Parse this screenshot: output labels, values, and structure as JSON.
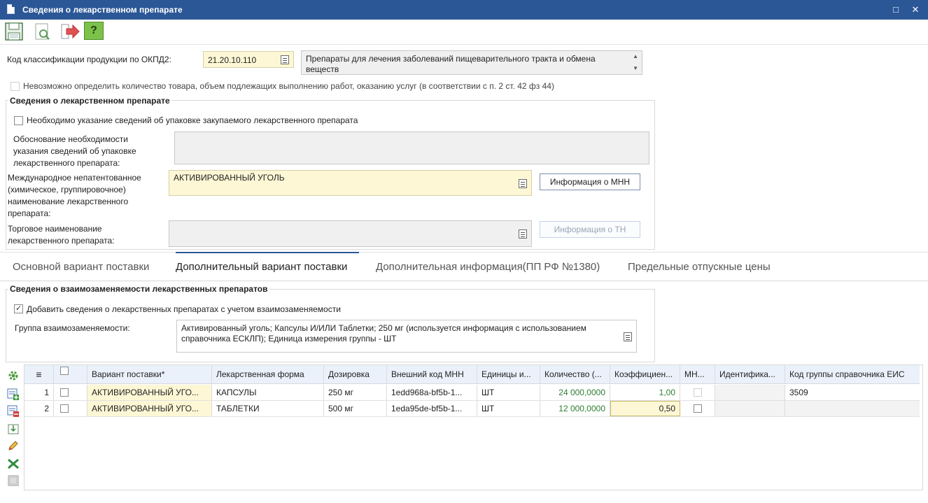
{
  "window": {
    "title": "Сведения о лекарственном препарате",
    "maximize_glyph": "□",
    "close_glyph": "✕"
  },
  "toolbar": {
    "buttons": [
      "save-icon",
      "preview-icon",
      "exit-icon",
      "help-icon"
    ],
    "help_glyph": "?"
  },
  "okpd": {
    "label": "Код классификации продукции по ОКПД2:",
    "code": "21.20.10.110",
    "description": "Препараты для лечения заболеваний пищеварительного тракта и обмена веществ"
  },
  "cannot_determine": {
    "label": "Невозможно определить количество товара, объем подлежащих выполнению работ, оказанию услуг (в соответствии с п. 2 ст. 42 фз 44)",
    "checked": false
  },
  "drug_info": {
    "group_title": "Сведения о лекарственном препарате",
    "packaging_check_label": "Необходимо указание сведений об упаковке закупаемого лекарственного препарата",
    "packaging_checked": false,
    "justification_label": "Обоснование необходимости указания сведений об упаковке лекарственного препарата:",
    "justification_value": "",
    "inn_label": "Международное непатентованное (химическое, группировочное) наименование лекарственного препарата:",
    "inn_value": "АКТИВИРОВАННЫЙ УГОЛЬ",
    "inn_button": "Информация о МНН",
    "trade_label": "Торговое наименование лекарственного препарата:",
    "trade_value": "",
    "trade_button": "Информация о ТН"
  },
  "tabs": [
    {
      "label": "Основной вариант поставки",
      "active": false
    },
    {
      "label": "Дополнительный вариант поставки",
      "active": true
    },
    {
      "label": "Дополнительная информация(ПП РФ №1380)",
      "active": false
    },
    {
      "label": "Предельные отпускные цены",
      "active": false
    }
  ],
  "interchange": {
    "group_title": "Сведения о взаимозаменяемости лекарственных препаратов",
    "add_check_label": "Добавить сведения о лекарственных препаратах с учетом взаимозаменяемости",
    "add_checked": true,
    "group_label": "Группа взаимозаменяемости:",
    "group_value": "Активированный уголь; Капсулы И/ИЛИ Таблетки; 250 мг (используется информация с использованием справочника ЕСКЛП); Единица измерения группы - ШТ"
  },
  "side_tools": [
    "settings-icon",
    "add-row-icon",
    "delete-row-icon",
    "import-icon",
    "edit-icon",
    "excel-icon",
    "table-icon"
  ],
  "grid": {
    "columns": [
      {
        "key": "menu",
        "label": "≡"
      },
      {
        "key": "check",
        "label": ""
      },
      {
        "key": "variant",
        "label": "Вариант поставки*"
      },
      {
        "key": "form",
        "label": "Лекарственная форма"
      },
      {
        "key": "dose",
        "label": "Дозировка"
      },
      {
        "key": "ext_code",
        "label": "Внешний код МНН"
      },
      {
        "key": "unit",
        "label": "Единицы и..."
      },
      {
        "key": "qty",
        "label": "Количество (..."
      },
      {
        "key": "coef",
        "label": "Коэффициен..."
      },
      {
        "key": "mnn",
        "label": "МН..."
      },
      {
        "key": "ident",
        "label": "Идентифика..."
      },
      {
        "key": "eis",
        "label": "Код группы справочника ЕИС"
      }
    ],
    "rows": [
      {
        "n": "1",
        "variant": "АКТИВИРОВАННЫЙ УГО...",
        "form": "КАПСУЛЫ",
        "dose": "250 мг",
        "ext_code": "1edd968a-bf5b-1...",
        "unit": "ШТ",
        "qty": "24 000,0000",
        "coef": "1,00",
        "eis": "3509"
      },
      {
        "n": "2",
        "variant": "АКТИВИРОВАННЫЙ УГО...",
        "form": "ТАБЛЕТКИ",
        "dose": "500 мг",
        "ext_code": "1eda95de-bf5b-1...",
        "unit": "ШТ",
        "qty": "12 000,0000",
        "coef": "0,50",
        "eis": ""
      }
    ]
  },
  "colors": {
    "titlebar": "#2b5797",
    "required_field": "#fdf7d5",
    "quantity_text": "#2e7d32"
  }
}
